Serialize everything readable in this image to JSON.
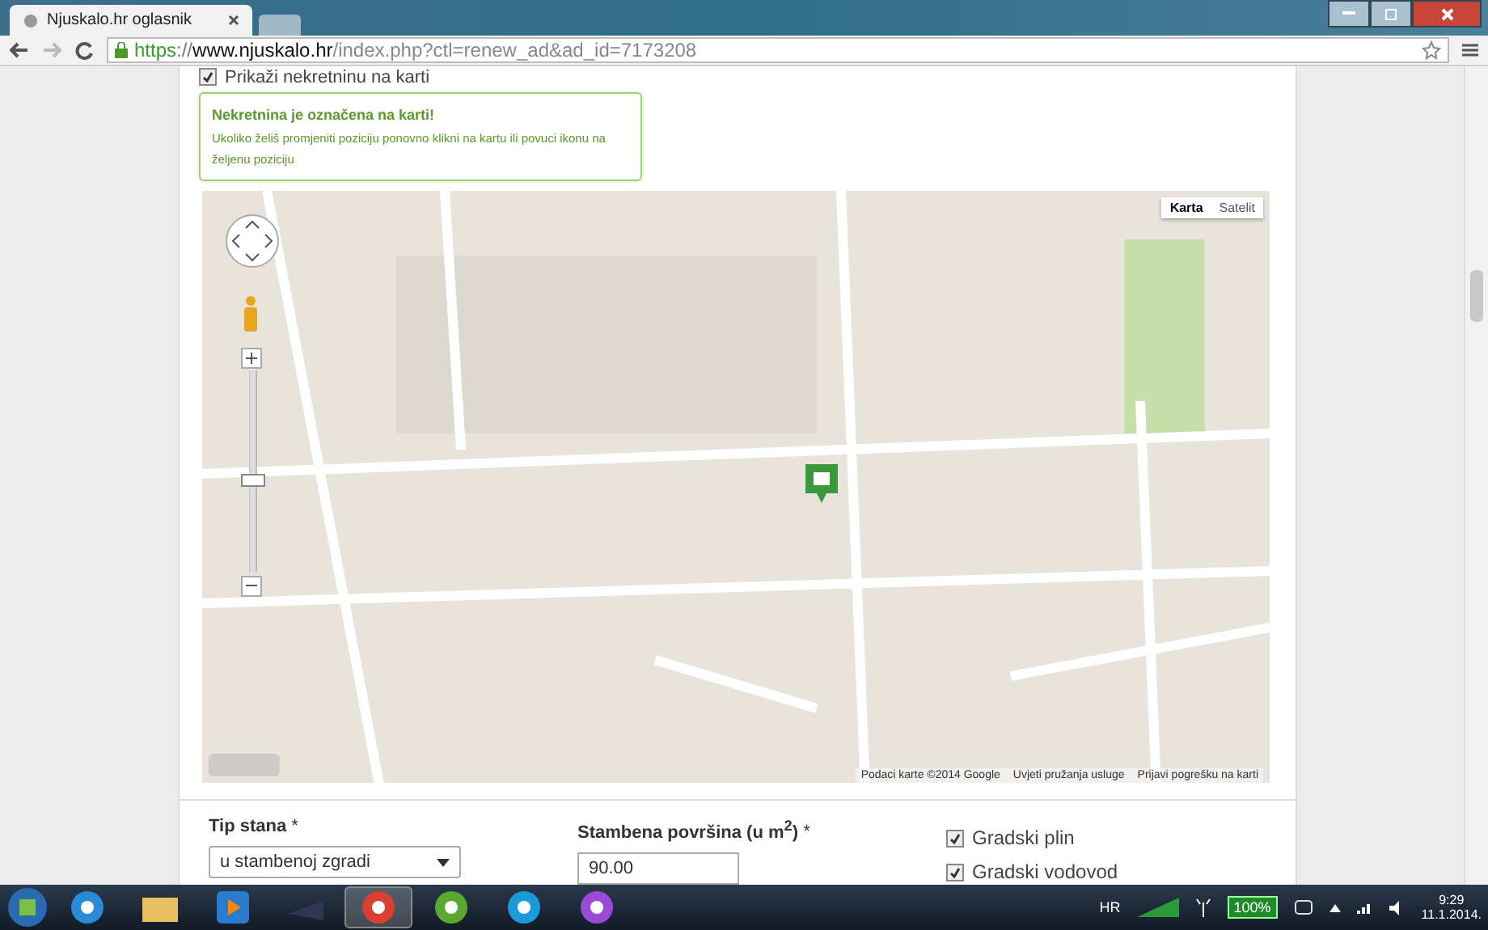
{
  "browser": {
    "tab_title": "Njuskalo.hr oglasnik",
    "url": {
      "scheme": "https",
      "separator": "://",
      "host": "www.njuskalo.hr",
      "path": "/index.php?ctl=renew_ad&ad_id=7173208"
    }
  },
  "page": {
    "show_on_map": {
      "label": "Prikaži nekretninu na karti",
      "checked": true
    },
    "notice": {
      "title": "Nekretnina je označena na karti!",
      "text": "Ukoliko želiš promjeniti poziciju ponovno klikni na kartu ili povuci ikonu na željenu poziciju"
    },
    "map": {
      "map_types": [
        {
          "label": "Karta",
          "selected": true
        },
        {
          "label": "Satelit",
          "selected": false
        }
      ],
      "zoom": {
        "level": 0.45
      },
      "attribution": [
        "Podaci karte ©2014 Google",
        "Uvjeti pružanja usluge",
        "Prijavi pogrešku na karti"
      ]
    },
    "form": {
      "apartment_type": {
        "label": "Tip stana",
        "required": "*",
        "value": "u stambenoj zgradi"
      },
      "area": {
        "label": "Stambena površina (u m$^{2}$)",
        "required": "*",
        "value": "90.00"
      },
      "utilities": [
        {
          "label": "Gradski plin",
          "checked": true
        },
        {
          "label": "Gradski vodovod",
          "checked": true
        }
      ]
    }
  },
  "taskbar": {
    "language": "HR",
    "battery": "100%",
    "time": "9:29",
    "date": "11.1.2014."
  }
}
